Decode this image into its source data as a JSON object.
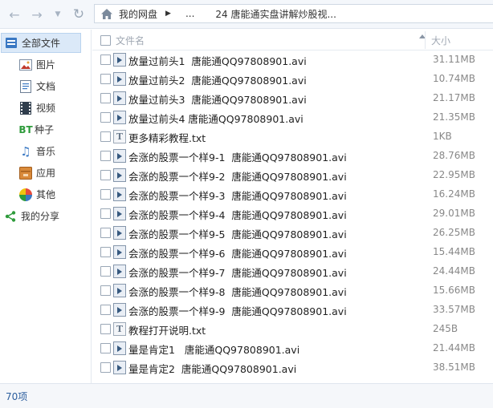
{
  "toolbar": {
    "back_icon": "arrow-left-icon",
    "forward_icon": "arrow-right-icon",
    "history_icon": "chevron-down-icon",
    "refresh_icon": "refresh-icon",
    "breadcrumb": {
      "root": "我的网盘",
      "ellipsis": "...",
      "current": "24 唐能通实盘讲解炒股视..."
    }
  },
  "sidebar": {
    "items": [
      {
        "label": "全部文件",
        "icon": "all-files-icon",
        "active": true
      },
      {
        "label": "图片",
        "icon": "image-icon"
      },
      {
        "label": "文档",
        "icon": "document-icon"
      },
      {
        "label": "视频",
        "icon": "video-icon"
      },
      {
        "label": "种子",
        "icon": "bt-icon"
      },
      {
        "label": "音乐",
        "icon": "music-icon"
      },
      {
        "label": "应用",
        "icon": "app-icon"
      },
      {
        "label": "其他",
        "icon": "other-icon"
      },
      {
        "label": "我的分享",
        "icon": "share-icon"
      }
    ]
  },
  "list": {
    "header_name": "文件名",
    "header_size": "大小",
    "files": [
      {
        "name": "放量过前头1  唐能通QQ97808901.avi",
        "size": "31.11MB",
        "type": "video"
      },
      {
        "name": "放量过前头2  唐能通QQ97808901.avi",
        "size": "10.74MB",
        "type": "video"
      },
      {
        "name": "放量过前头3  唐能通QQ97808901.avi",
        "size": "21.17MB",
        "type": "video"
      },
      {
        "name": "放量过前头4 唐能通QQ97808901.avi",
        "size": "21.35MB",
        "type": "video"
      },
      {
        "name": "更多精彩教程.txt",
        "size": "1KB",
        "type": "text"
      },
      {
        "name": "会涨的股票一个样9-1  唐能通QQ97808901.avi",
        "size": "28.76MB",
        "type": "video"
      },
      {
        "name": "会涨的股票一个样9-2  唐能通QQ97808901.avi",
        "size": "22.95MB",
        "type": "video"
      },
      {
        "name": "会涨的股票一个样9-3  唐能通QQ97808901.avi",
        "size": "16.24MB",
        "type": "video"
      },
      {
        "name": "会涨的股票一个样9-4  唐能通QQ97808901.avi",
        "size": "29.01MB",
        "type": "video"
      },
      {
        "name": "会涨的股票一个样9-5  唐能通QQ97808901.avi",
        "size": "26.25MB",
        "type": "video"
      },
      {
        "name": "会涨的股票一个样9-6  唐能通QQ97808901.avi",
        "size": "15.44MB",
        "type": "video"
      },
      {
        "name": "会涨的股票一个样9-7  唐能通QQ97808901.avi",
        "size": "24.44MB",
        "type": "video"
      },
      {
        "name": "会涨的股票一个样9-8  唐能通QQ97808901.avi",
        "size": "15.66MB",
        "type": "video"
      },
      {
        "name": "会涨的股票一个样9-9  唐能通QQ97808901.avi",
        "size": "33.57MB",
        "type": "video"
      },
      {
        "name": "教程打开说明.txt",
        "size": "245B",
        "type": "text"
      },
      {
        "name": "量是肯定1   唐能通QQ97808901.avi",
        "size": "21.44MB",
        "type": "video"
      },
      {
        "name": "量是肯定2  唐能通QQ97808901.avi",
        "size": "38.51MB",
        "type": "video"
      }
    ]
  },
  "status": {
    "count": "70项"
  },
  "colors": {
    "accent": "#2b5e9e",
    "active_bg": "#dbe9f8",
    "toolbar_bg": "#f4f7fb"
  }
}
